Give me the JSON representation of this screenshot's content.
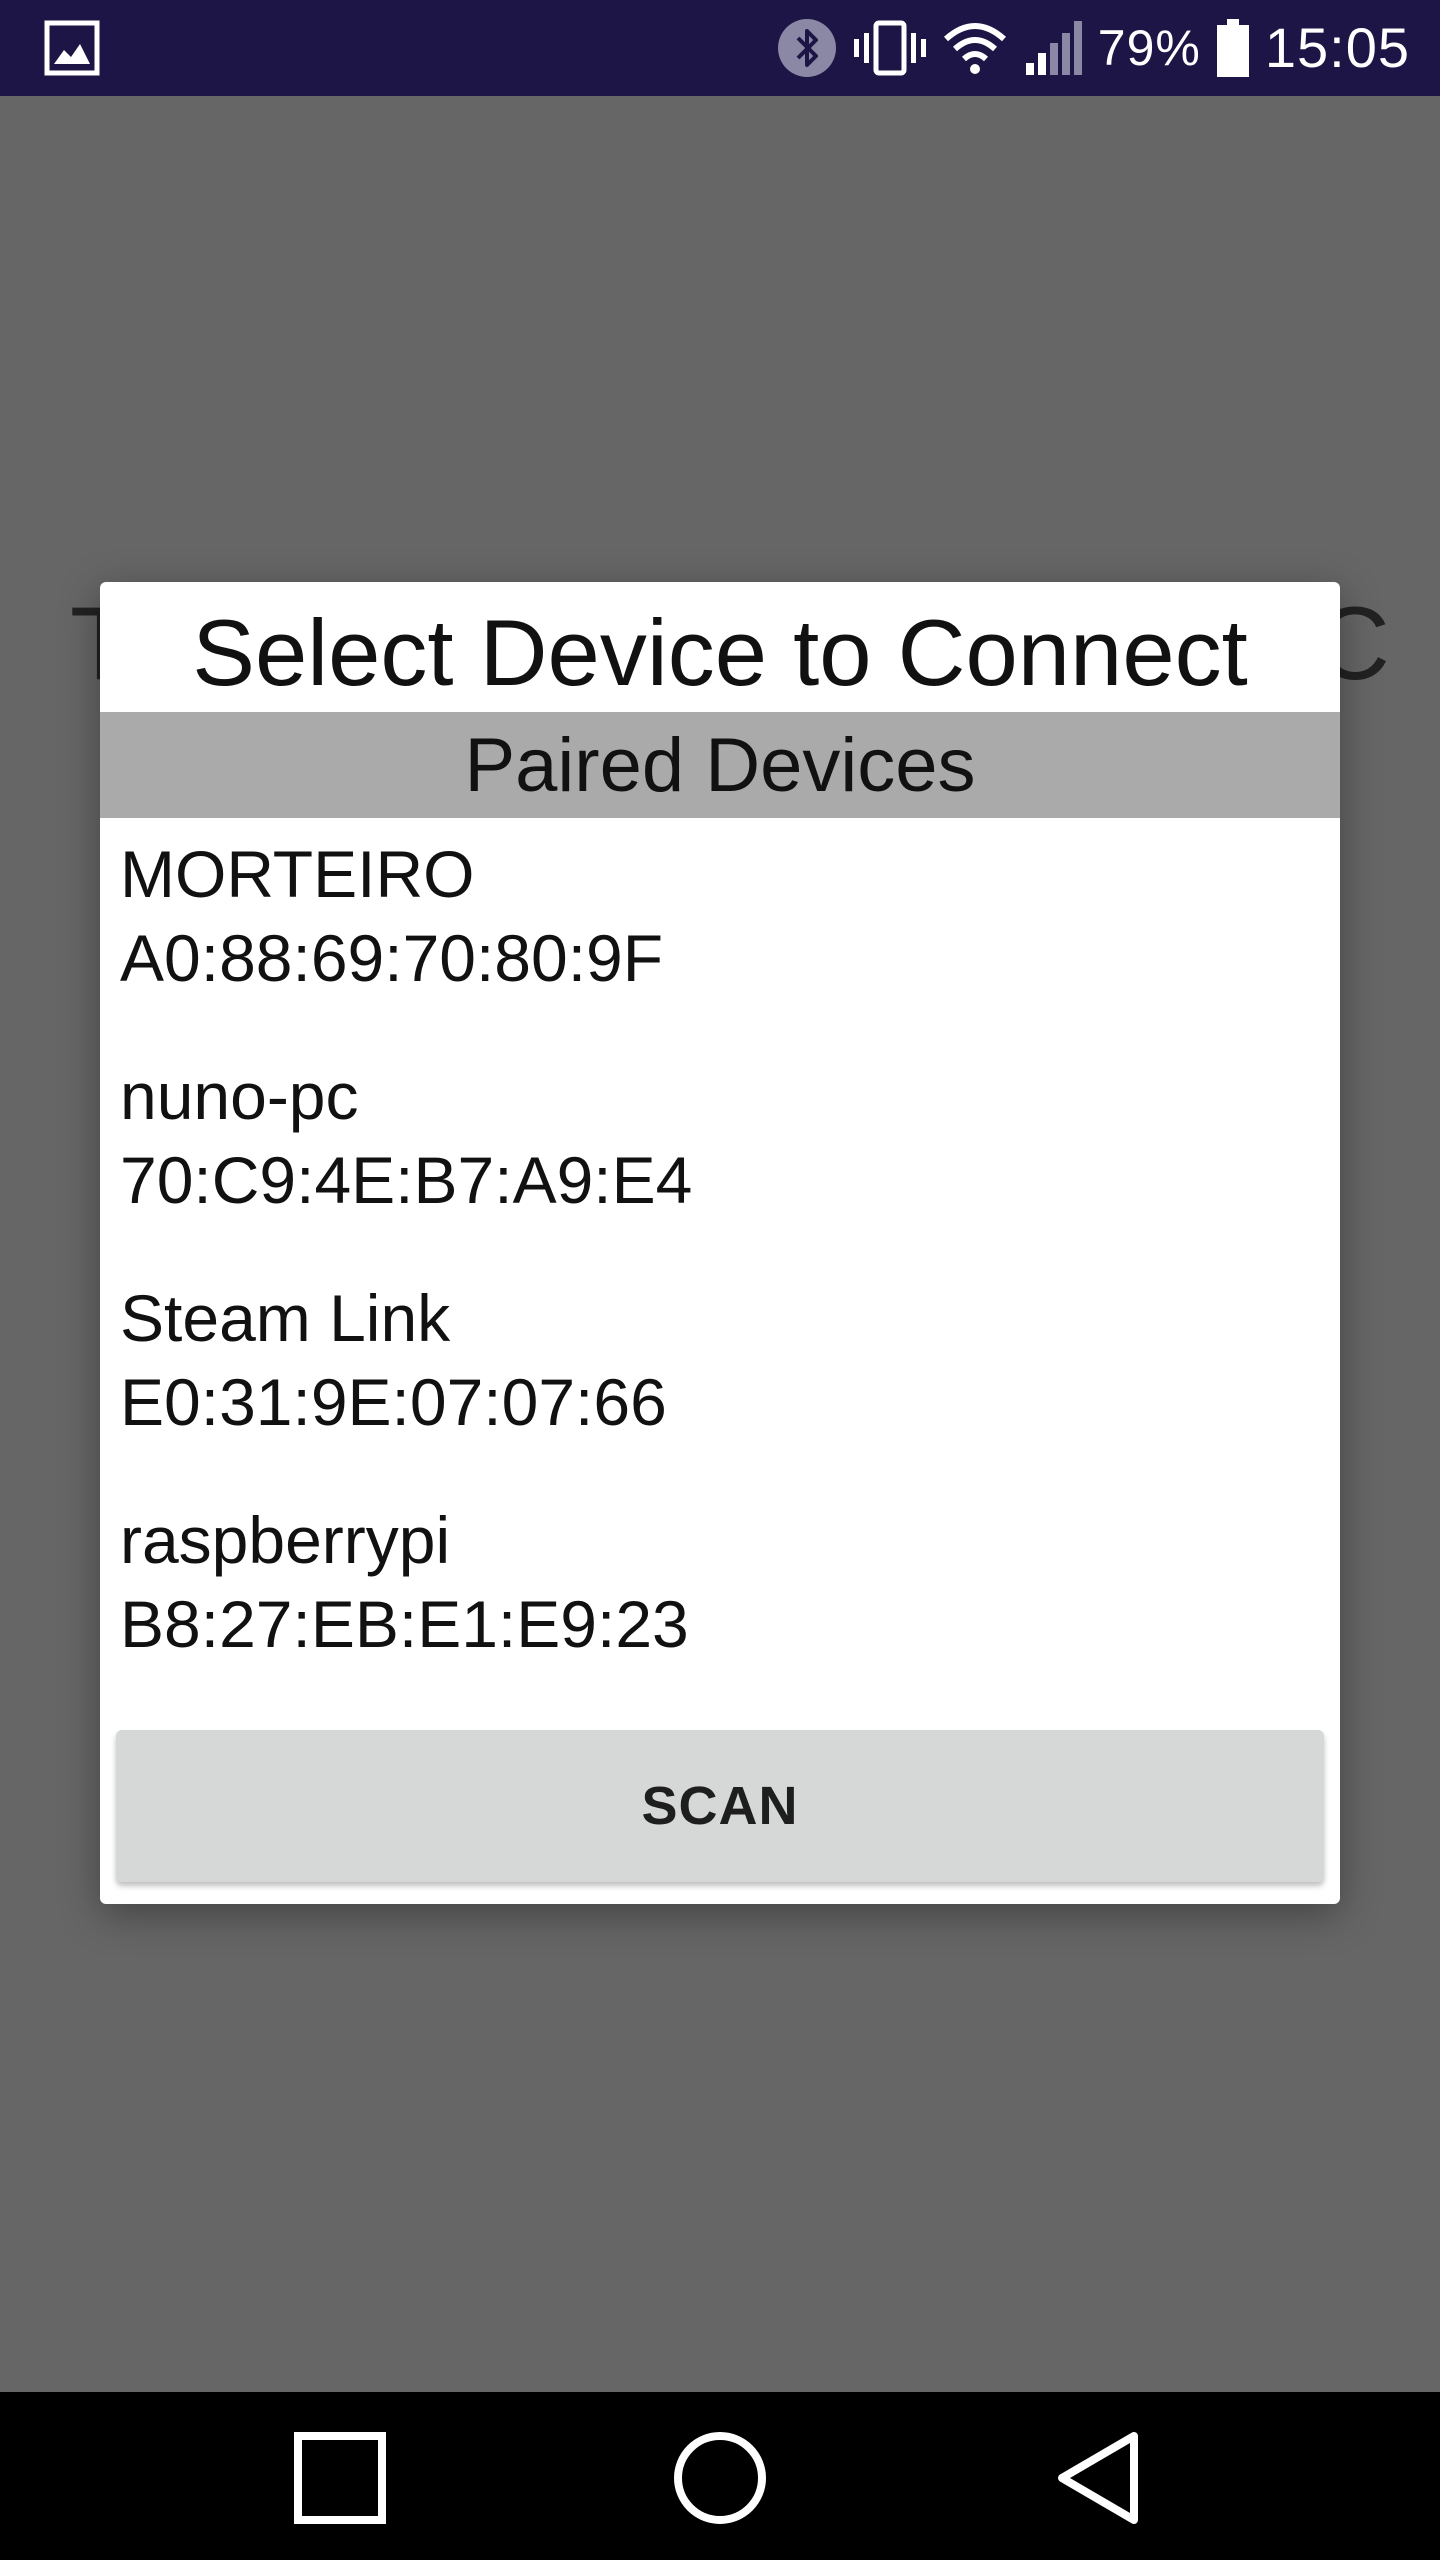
{
  "status_bar": {
    "notification_icon": "gallery-icon",
    "icons": [
      "bluetooth-icon",
      "vibrate-icon",
      "wifi-icon",
      "signal-icon",
      "battery-icon"
    ],
    "battery_percent": "79%",
    "time": "15:05"
  },
  "background": {
    "title_left": "T",
    "title_right": "C"
  },
  "dialog": {
    "title": "Select Device to Connect",
    "section_header": "Paired Devices",
    "devices": [
      {
        "name": "MORTEIRO",
        "address": "A0:88:69:70:80:9F"
      },
      {
        "name": "nuno-pc",
        "address": "70:C9:4E:B7:A9:E4"
      },
      {
        "name": "Steam Link",
        "address": "E0:31:9E:07:07:66"
      },
      {
        "name": "raspberrypi",
        "address": "B8:27:EB:E1:E9:23"
      }
    ],
    "scan_label": "SCAN"
  },
  "nav_bar": {
    "buttons": [
      "recents-icon",
      "home-icon",
      "back-icon"
    ]
  },
  "colors": {
    "status_bar_bg": "#1c1545",
    "scrim": "#666666",
    "section_header_bg": "#aaaaaa",
    "button_bg": "#d6d7d7",
    "nav_bar_bg": "#000000"
  }
}
